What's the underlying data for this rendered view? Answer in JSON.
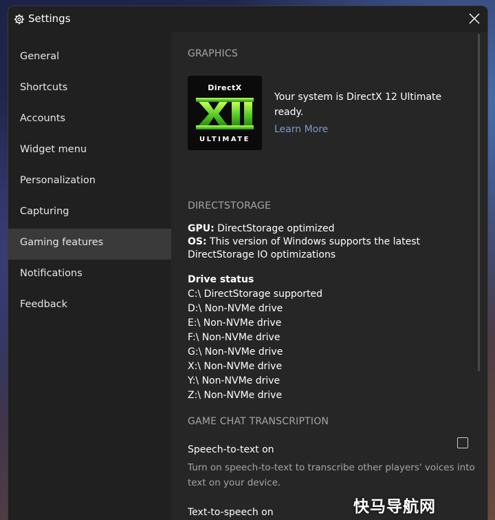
{
  "window": {
    "title": "Settings"
  },
  "sidebar": {
    "items": [
      {
        "label": "General"
      },
      {
        "label": "Shortcuts"
      },
      {
        "label": "Accounts"
      },
      {
        "label": "Widget menu"
      },
      {
        "label": "Personalization"
      },
      {
        "label": "Capturing"
      },
      {
        "label": "Gaming features",
        "active": true
      },
      {
        "label": "Notifications"
      },
      {
        "label": "Feedback"
      }
    ]
  },
  "graphics": {
    "heading": "GRAPHICS",
    "logo_top": "DirectX",
    "logo_bottom": "ULTIMATE",
    "status": "Your system is DirectX 12 Ultimate ready.",
    "learn_more": "Learn More"
  },
  "directstorage": {
    "heading": "DIRECTSTORAGE",
    "gpu_label": "GPU:",
    "gpu_value": " DirectStorage optimized",
    "os_label": "OS:",
    "os_value": " This version of Windows supports the latest DirectStorage IO optimizations",
    "drive_status_label": "Drive status",
    "drives": [
      "C:\\ DirectStorage supported",
      "D:\\ Non-NVMe drive",
      "E:\\ Non-NVMe drive",
      "F:\\ Non-NVMe drive",
      "G:\\ Non-NVMe drive",
      "X:\\ Non-NVMe drive",
      "Y:\\ Non-NVMe drive",
      "Z:\\ Non-NVMe drive"
    ]
  },
  "transcription": {
    "heading": "GAME CHAT TRANSCRIPTION",
    "stt_label": "Speech-to-text on",
    "stt_checked": false,
    "stt_desc": "Turn on speech-to-text to transcribe other players' voices into text on your device.",
    "tts_label": "Text-to-speech on"
  },
  "watermark": "快马导航网",
  "icons": {
    "title": "gear-icon",
    "close": "close-icon"
  }
}
